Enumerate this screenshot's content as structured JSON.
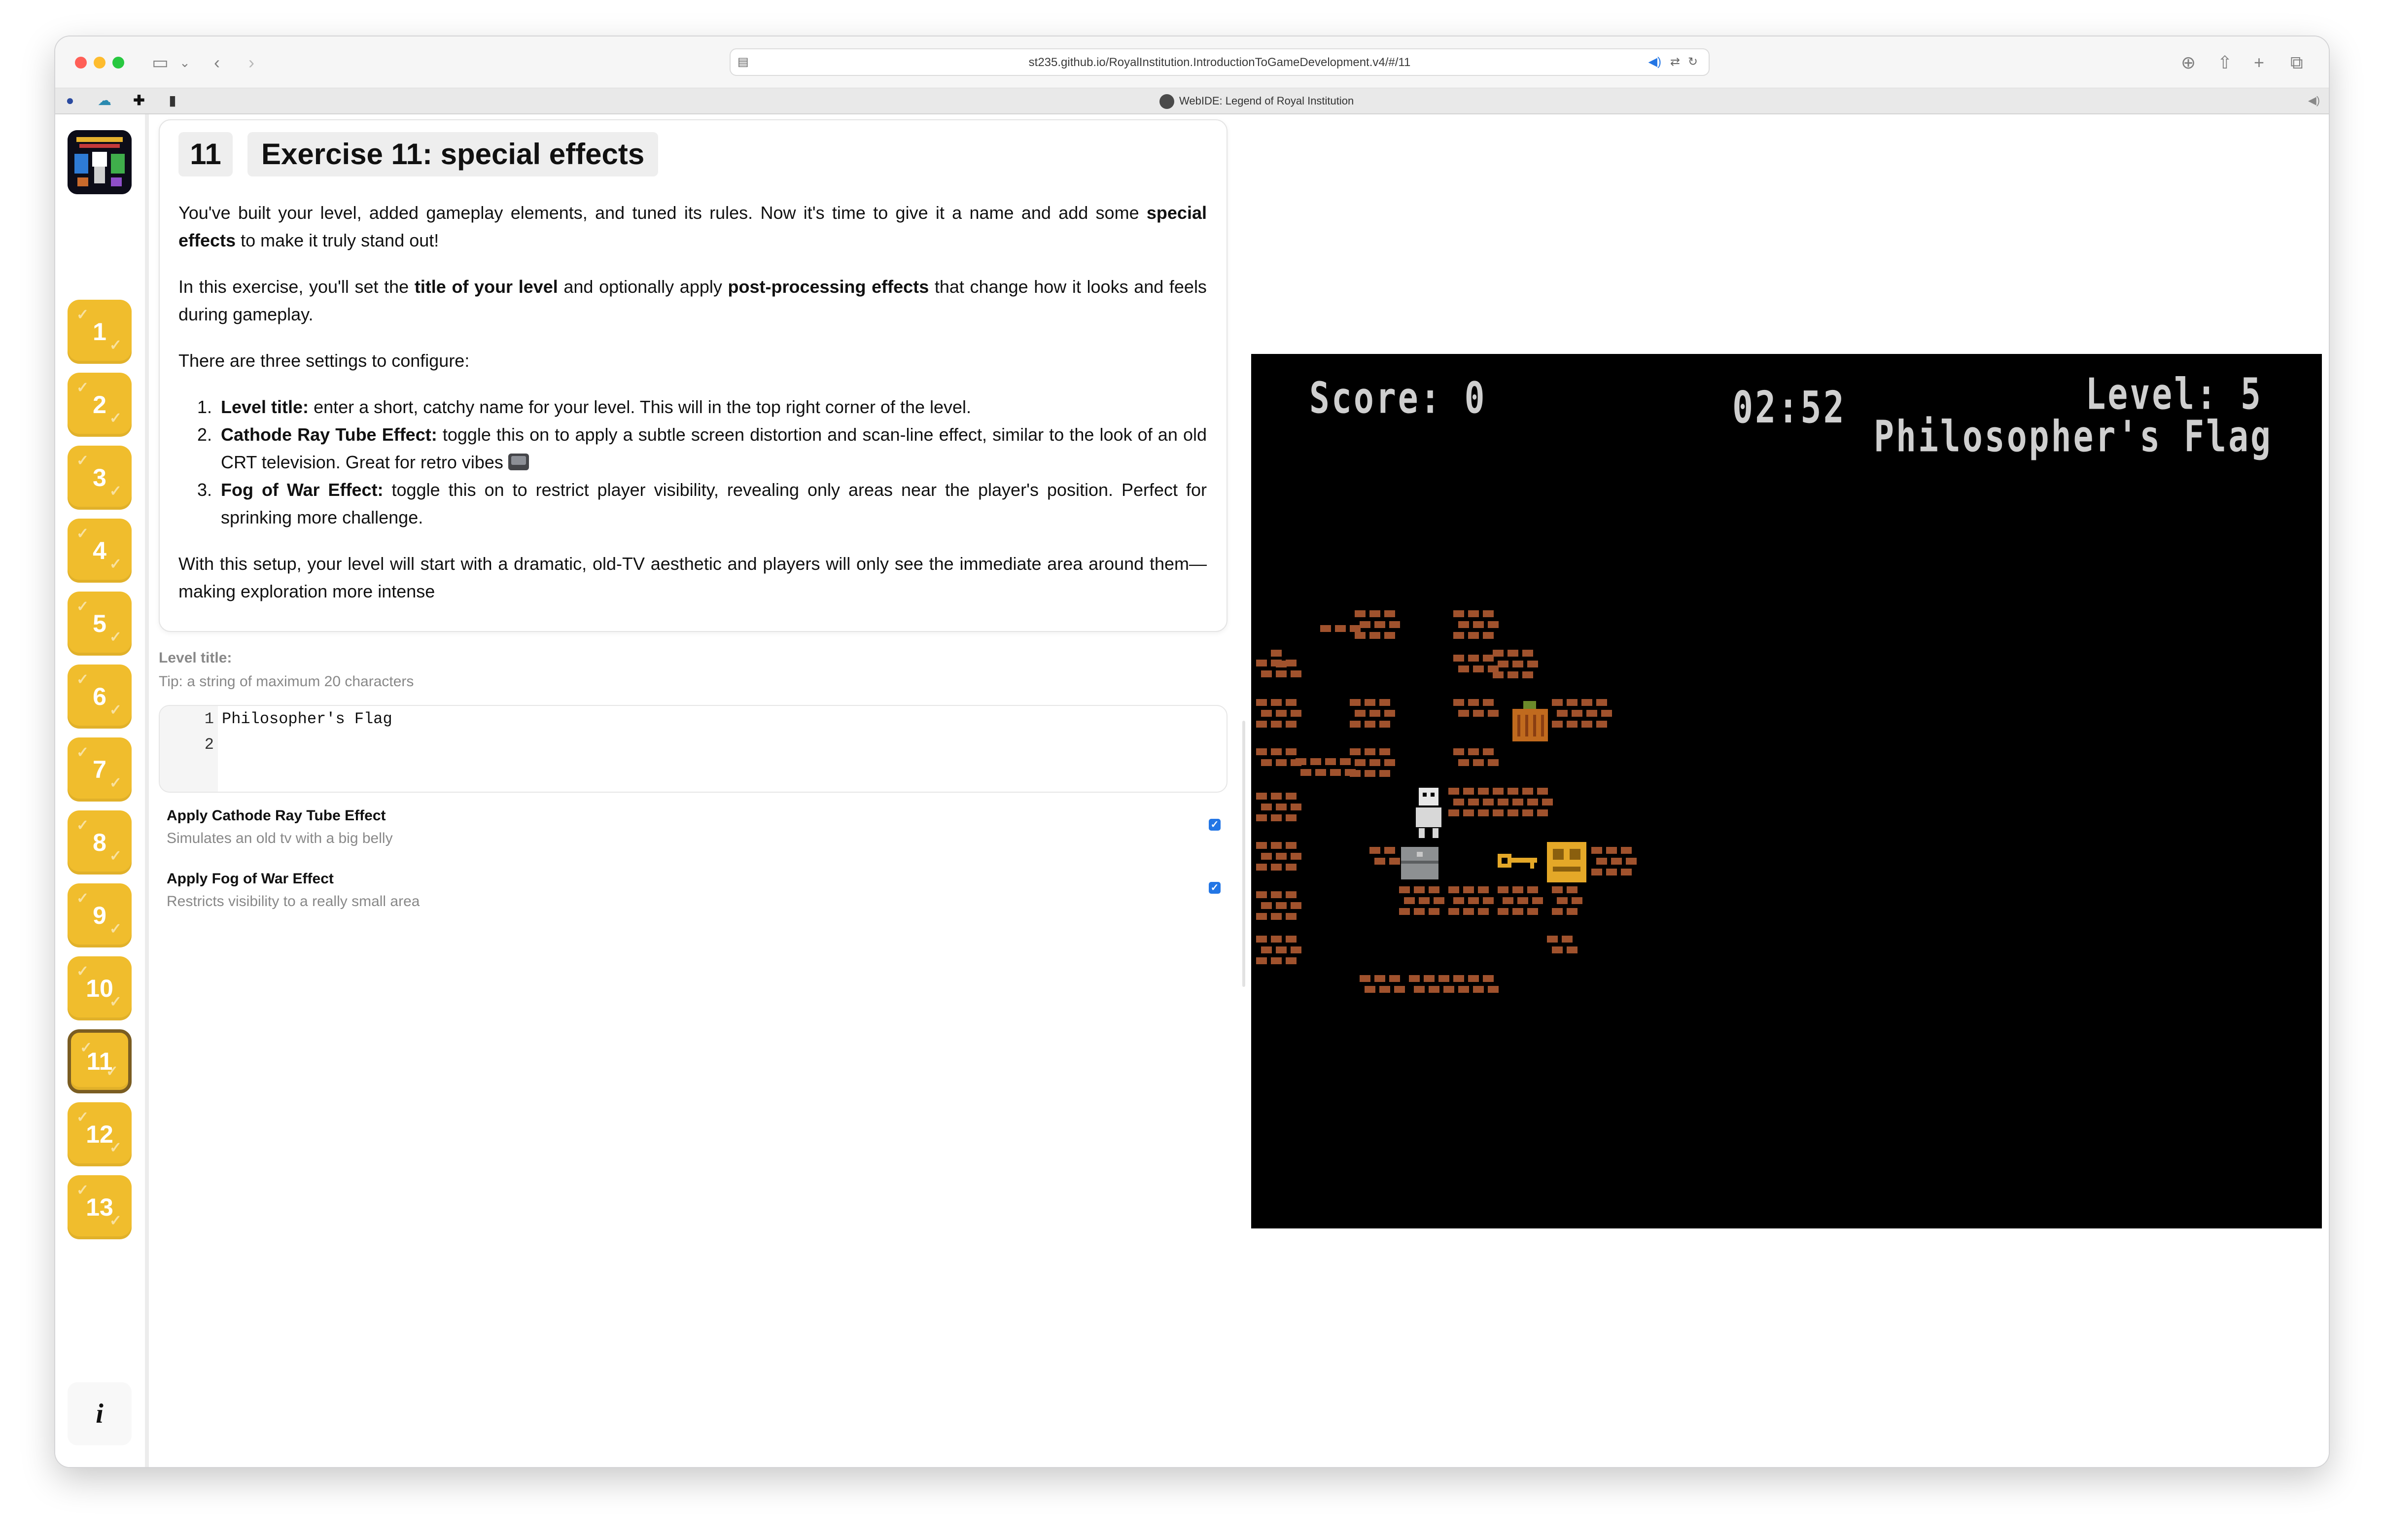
{
  "browser": {
    "url": "st235.github.io/RoyalInstitution.IntroductionToGameDevelopment.v4/#/11",
    "tab_title": "WebIDE: Legend of Royal Institution"
  },
  "sidebar": {
    "exercises": [
      "1",
      "2",
      "3",
      "4",
      "5",
      "6",
      "7",
      "8",
      "9",
      "10",
      "11",
      "12",
      "13"
    ],
    "active_exercise": "11",
    "info_label": "i"
  },
  "exercise": {
    "number": "11",
    "title": "Exercise 11: special effects",
    "intro_1": "You've built your level, added gameplay elements, and tuned its rules. Now it's time to give it a name and add some",
    "intro_1_bold": "special effects",
    "intro_1_end": "to make it truly stand out!",
    "intro_2_start": "In this exercise, you'll set the",
    "intro_2_bold_1": "title of your level",
    "intro_2_mid": "and optionally apply",
    "intro_2_bold_2": "post-processing effects",
    "intro_2_end": "that change how it looks and feels during gameplay.",
    "settings_lead": "There are three settings to configure:",
    "settings": [
      {
        "name": "Level title:",
        "text": "enter a short, catchy name for your level. This will in the top right corner of the level."
      },
      {
        "name": "Cathode Ray Tube Effect:",
        "text": "toggle this on to apply a subtle screen distortion and scan-line effect, similar to the look of an old CRT television. Great for retro vibes"
      },
      {
        "name": "Fog of War Effect:",
        "text": "toggle this on to restrict player visibility, revealing only areas near the player's position. Perfect for sprinking more challenge."
      }
    ],
    "outro": "With this setup, your level will start with a dramatic, old-TV aesthetic and players will only see the immediate area around them—making exploration more intense"
  },
  "level_title_field": {
    "label": "Level title:",
    "tip": "Tip: a string of maximum 20 characters",
    "lines": [
      {
        "n": "1",
        "text": "Philosopher's Flag"
      },
      {
        "n": "2",
        "text": ""
      }
    ]
  },
  "options": [
    {
      "title": "Apply Cathode Ray Tube Effect",
      "description": "Simulates an old tv with a big belly",
      "checked": true
    },
    {
      "title": "Apply Fog of War Effect",
      "description": "Restricts visibility to a really small area",
      "checked": true
    }
  ],
  "game": {
    "score_label": "Score: 0",
    "timer": "02:52",
    "level_label": "Level: 5",
    "level_name": "Philosopher's Flag",
    "colors": {
      "brick": "#a0522d",
      "hud_text": "#cfcfcf",
      "treasure": "#e4a828",
      "background": "#000000"
    }
  }
}
